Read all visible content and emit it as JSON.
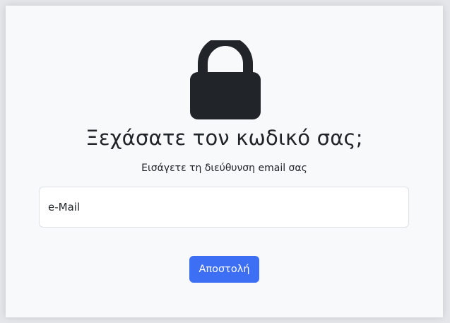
{
  "form": {
    "title": "Ξεχάσατε τον κωδικό σας;",
    "subtitle": "Εισάγετε τη διεύθυνση email σας",
    "email_placeholder": "e-Mail",
    "email_value": "",
    "submit_label": "Αποστολή"
  },
  "icons": {
    "header_icon": "lock-icon"
  },
  "colors": {
    "icon": "#212529",
    "text": "#212529",
    "button_background": "#3d6ff5",
    "button_text": "#ffffff",
    "card_background": "#f8f9fa"
  }
}
